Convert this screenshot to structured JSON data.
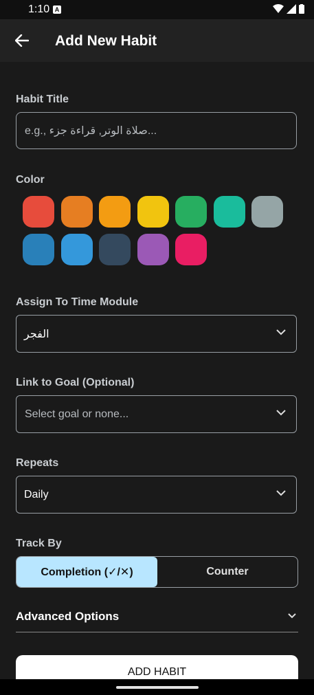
{
  "status_bar": {
    "time": "1:10",
    "notification_badge": "A"
  },
  "app_bar": {
    "title": "Add New Habit"
  },
  "form": {
    "habit_title": {
      "label": "Habit Title",
      "placeholder": "e.g., صلاة الوتر, قراءة جزء..."
    },
    "color": {
      "label": "Color",
      "swatches": [
        "#e74c3c",
        "#e67e22",
        "#f39c12",
        "#f1c40f",
        "#27ae60",
        "#1abc9c",
        "#95a5a6",
        "#2980b9",
        "#3498db",
        "#34495e",
        "#9b59b6",
        "#e91e63"
      ]
    },
    "time_module": {
      "label": "Assign To Time Module",
      "value": "الفجر"
    },
    "goal": {
      "label": "Link to Goal (Optional)",
      "placeholder": "Select goal or none..."
    },
    "repeats": {
      "label": "Repeats",
      "value": "Daily"
    },
    "track_by": {
      "label": "Track By",
      "options": [
        "Completion (✓/✕)",
        "Counter"
      ],
      "selected": "Completion (✓/✕)"
    },
    "advanced": {
      "label": "Advanced Options"
    },
    "submit_label": "ADD HABIT"
  }
}
